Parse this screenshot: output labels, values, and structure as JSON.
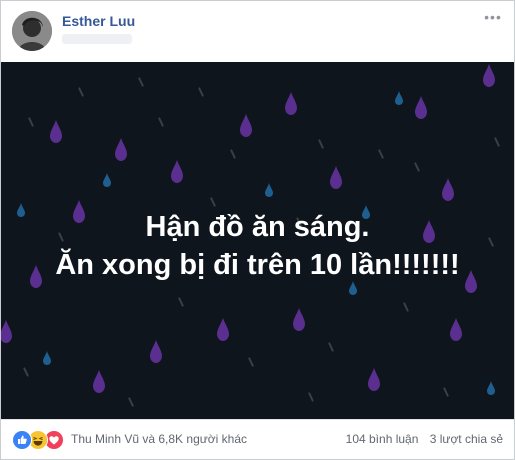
{
  "post": {
    "author_name": "Esther Luu",
    "more_icon": "ellipsis-icon",
    "image": {
      "background_color": "#0f151d",
      "drop_colors": [
        "#5a2f8f",
        "#1f5f8f"
      ],
      "text_color": "#ffffff",
      "lines": [
        "Hận đồ ăn sáng.",
        "Ăn xong bị đi trên 10 lần!!!!!!!"
      ]
    },
    "footer": {
      "reaction_icons": [
        "like-reaction-icon",
        "haha-reaction-icon",
        "love-reaction-icon"
      ],
      "likers_text": "Thu Minh Vũ và 6,8K người khác",
      "comments_text": "104 bình luận",
      "shares_text": "3 lượt chia sẻ"
    }
  }
}
